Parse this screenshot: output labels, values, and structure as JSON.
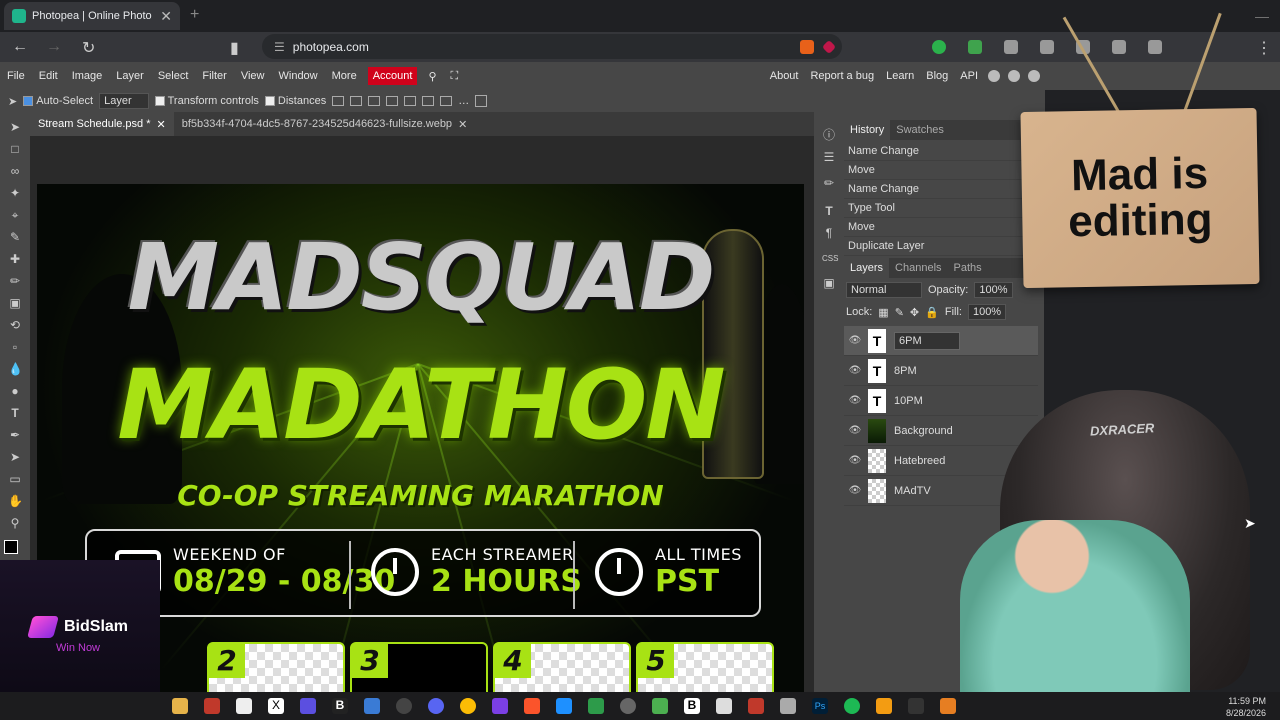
{
  "browser": {
    "tab_title": "Photopea | Online Photo Editor",
    "url": "photopea.com"
  },
  "menu": {
    "items": [
      "File",
      "Edit",
      "Image",
      "Layer",
      "Select",
      "Filter",
      "View",
      "Window",
      "More"
    ],
    "account": "Account",
    "right_items": [
      "About",
      "Report a bug",
      "Learn",
      "Blog",
      "API"
    ]
  },
  "options": {
    "auto_select": "Auto-Select",
    "layer_select": "Layer",
    "transform_controls": "Transform controls",
    "distances": "Distances"
  },
  "documents": {
    "tabs": [
      {
        "label": "Stream Schedule.psd *",
        "active": true
      },
      {
        "label": "bf5b334f-4704-4dc5-8767-234525d46623-fullsize.webp",
        "active": false
      }
    ]
  },
  "poster": {
    "title1": "MADSQUAD",
    "title2": "MADATHON",
    "subtitle": "CO-OP STREAMING MARATHON",
    "info": [
      {
        "line1": "WEEKEND OF",
        "line2": "08/29 - 08/30"
      },
      {
        "line1": "EACH STREAMER",
        "line2": "2 HOURS"
      },
      {
        "line1": "ALL TIMES",
        "line2": "PST"
      }
    ],
    "slots": [
      "2",
      "3",
      "4",
      "5"
    ]
  },
  "panel": {
    "top_tabs": [
      "History",
      "Swatches"
    ],
    "history": [
      "Name Change",
      "Move",
      "Name Change",
      "Type Tool",
      "Move",
      "Duplicate Layer"
    ],
    "layer_tabs": [
      "Layers",
      "Channels",
      "Paths"
    ],
    "blend_mode": "Normal",
    "opacity_label": "Opacity:",
    "opacity_value": "100%",
    "lock_label": "Lock:",
    "fill_label": "Fill:",
    "fill_value": "100%",
    "layers": [
      {
        "name": "6PM",
        "type": "text",
        "editing": true
      },
      {
        "name": "8PM",
        "type": "text"
      },
      {
        "name": "10PM",
        "type": "text"
      },
      {
        "name": "Background",
        "type": "image"
      },
      {
        "name": "Hatebreed",
        "type": "image"
      },
      {
        "name": "MAdTV",
        "type": "empty"
      }
    ]
  },
  "overlay": {
    "sign_line1": "Mad is",
    "sign_line2": "editing",
    "chair_brand": "DXRACER",
    "ad_name": "BidSlam",
    "ad_sub": "Win Now"
  },
  "taskbar": {
    "time": "11:59 PM",
    "date": "8/28/2026"
  },
  "colors": {
    "accent_green": "#a8e214",
    "account_red": "#d0021b",
    "ui_gray": "#474747"
  }
}
